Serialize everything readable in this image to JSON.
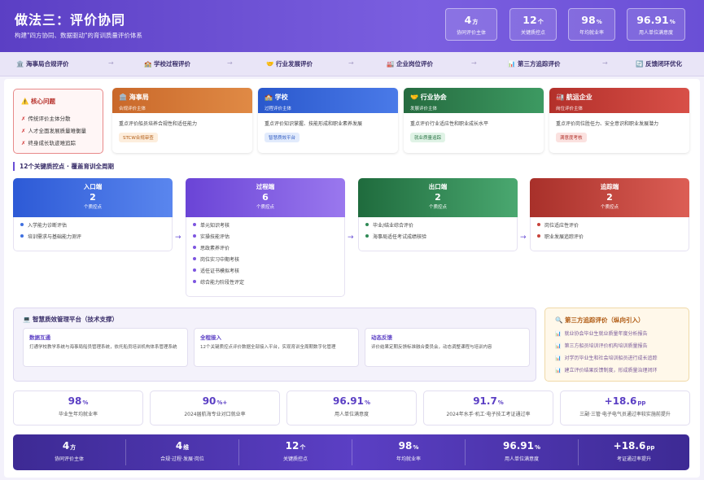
{
  "header": {
    "title": "做法三：评价协同",
    "subtitle": "构建\"四方协同、数据驱动\"的育训质量评价体系",
    "stats": [
      {
        "value": "4",
        "unit": "方",
        "label": "协同评价主体"
      },
      {
        "value": "12",
        "unit": "个",
        "label": "关键质控点"
      },
      {
        "value": "98",
        "unit": "%",
        "label": "年均就业率"
      },
      {
        "value": "96.91",
        "unit": "%",
        "label": "用人单位满意度"
      }
    ]
  },
  "flow": [
    {
      "icon": "🏛️",
      "label": "海事局合规评价"
    },
    {
      "icon": "🏫",
      "label": "学校过程评价"
    },
    {
      "icon": "🤝",
      "label": "行业发展评价"
    },
    {
      "icon": "🏭",
      "label": "企业岗位评价"
    },
    {
      "icon": "📊",
      "label": "第三方追踪评价"
    },
    {
      "icon": "🔄",
      "label": "反馈闭环优化"
    }
  ],
  "flow_arrow": "→",
  "core_problem": {
    "icon": "⚠️",
    "title": "核心问题",
    "mark": "✗",
    "items": [
      "传统评价主体分散",
      "人才全面发展质量难衡量",
      "终身成长轨迹难追踪"
    ]
  },
  "subjects": [
    {
      "icon": "🏛️",
      "name": "海事局",
      "role": "合规评价主体",
      "desc": "重点评价船员培养合规性和适任能力",
      "tag": "STCW合规审查",
      "color": "#d9772f",
      "tag_bg": "#fdeedd",
      "tag_fg": "#b05a12"
    },
    {
      "icon": "🏫",
      "name": "学校",
      "role": "过程评价主体",
      "desc": "重点评价知识掌握、技能形成和职业素养发展",
      "tag": "智慧质效平台",
      "color": "#2f63d8",
      "tag_bg": "#e2ebfc",
      "tag_fg": "#2f5bc0"
    },
    {
      "icon": "🤝",
      "name": "行业协会",
      "role": "发展评价主体",
      "desc": "重点评价行业适应性和职业成长水平",
      "tag": "就业质量追踪",
      "color": "#2f7d4b",
      "tag_bg": "#e0f3e6",
      "tag_fg": "#2a7345"
    },
    {
      "icon": "🏭",
      "name": "航运企业",
      "role": "岗位评价主体",
      "desc": "重点评价岗位胜任力、安全意识和职业发展潜力",
      "tag": "满意度考核",
      "color": "#c23a33",
      "tag_bg": "#fbe2e0",
      "tag_fg": "#b03029"
    }
  ],
  "section_title": "12个关键质控点 · 覆盖育训全周期",
  "stages": [
    {
      "name": "入口端",
      "count": "2",
      "unit": "个质控点",
      "color": "#3f6fe0",
      "items": [
        "入学能力诊断评估",
        "培训需求与基础能力测评"
      ]
    },
    {
      "name": "过程端",
      "count": "6",
      "unit": "个质控点",
      "color": "#7d55e0",
      "items": [
        "单元知识考核",
        "实操技能评估",
        "思政素养评价",
        "岗位实习中期考核",
        "适任证书模拟考核",
        "综合能力阶段性评定"
      ]
    },
    {
      "name": "出口端",
      "count": "2",
      "unit": "个质控点",
      "color": "#2f8a55",
      "items": [
        "毕业/结业综合评价",
        "海事局适任考试成绩核验"
      ]
    },
    {
      "name": "追踪端",
      "count": "2",
      "unit": "个质控点",
      "color": "#c7423b",
      "items": [
        "岗位适应性评价",
        "职业发展追踪评价"
      ]
    }
  ],
  "stage_arrow": "→",
  "platform": {
    "icon": "💻",
    "title": "智慧质效管理平台（技术支撑）",
    "boxes": [
      {
        "title": "数据互通",
        "desc": "打通学校教学系统与海事局船员管理系统，依托船员培训机构体系管理系统"
      },
      {
        "title": "全程接入",
        "desc": "12个关键质控点评价数据全部接入平台，实现育训全周期数字化管理"
      },
      {
        "title": "动态反馈",
        "desc": "评价结果定期反馈标准融合委员会，动态调整课程与培训内容"
      }
    ]
  },
  "third_party": {
    "icon": "🔍",
    "title": "第三方追踪评价（纵向引入）",
    "bullet": "📊",
    "items": [
      "就业协会毕业生就业质量年度分析报告",
      "第三方船员培训评价机构培训质量报告",
      "对学历毕业生和社会培训船员进行成长追踪",
      "建立评价结果反馈制度，形成质量治理闭环"
    ]
  },
  "kpis": [
    {
      "value": "98",
      "unit": "%",
      "label": "毕业生年均就业率"
    },
    {
      "value": "90",
      "unit": "%+",
      "label": "2024届航海专业对口就业率"
    },
    {
      "value": "96.91",
      "unit": "%",
      "label": "用人单位满意度"
    },
    {
      "value": "91.7",
      "unit": "%",
      "label": "2024年水手·机工·电子技工考证通过率"
    },
    {
      "value": "+18.6",
      "unit": "pp",
      "label": "三副·三管·电子电气员通过率较实施前提升"
    }
  ],
  "bottom": [
    {
      "value": "4",
      "unit": "方",
      "label": "协同评价主体"
    },
    {
      "value": "4",
      "unit": "维",
      "label": "合规·过程·发展·岗位"
    },
    {
      "value": "12",
      "unit": "个",
      "label": "关键质控点"
    },
    {
      "value": "98",
      "unit": "%",
      "label": "年均就业率"
    },
    {
      "value": "96.91",
      "unit": "%",
      "label": "用人单位满意度"
    },
    {
      "value": "+18.6",
      "unit": "pp",
      "label": "考证通过率提升"
    }
  ]
}
